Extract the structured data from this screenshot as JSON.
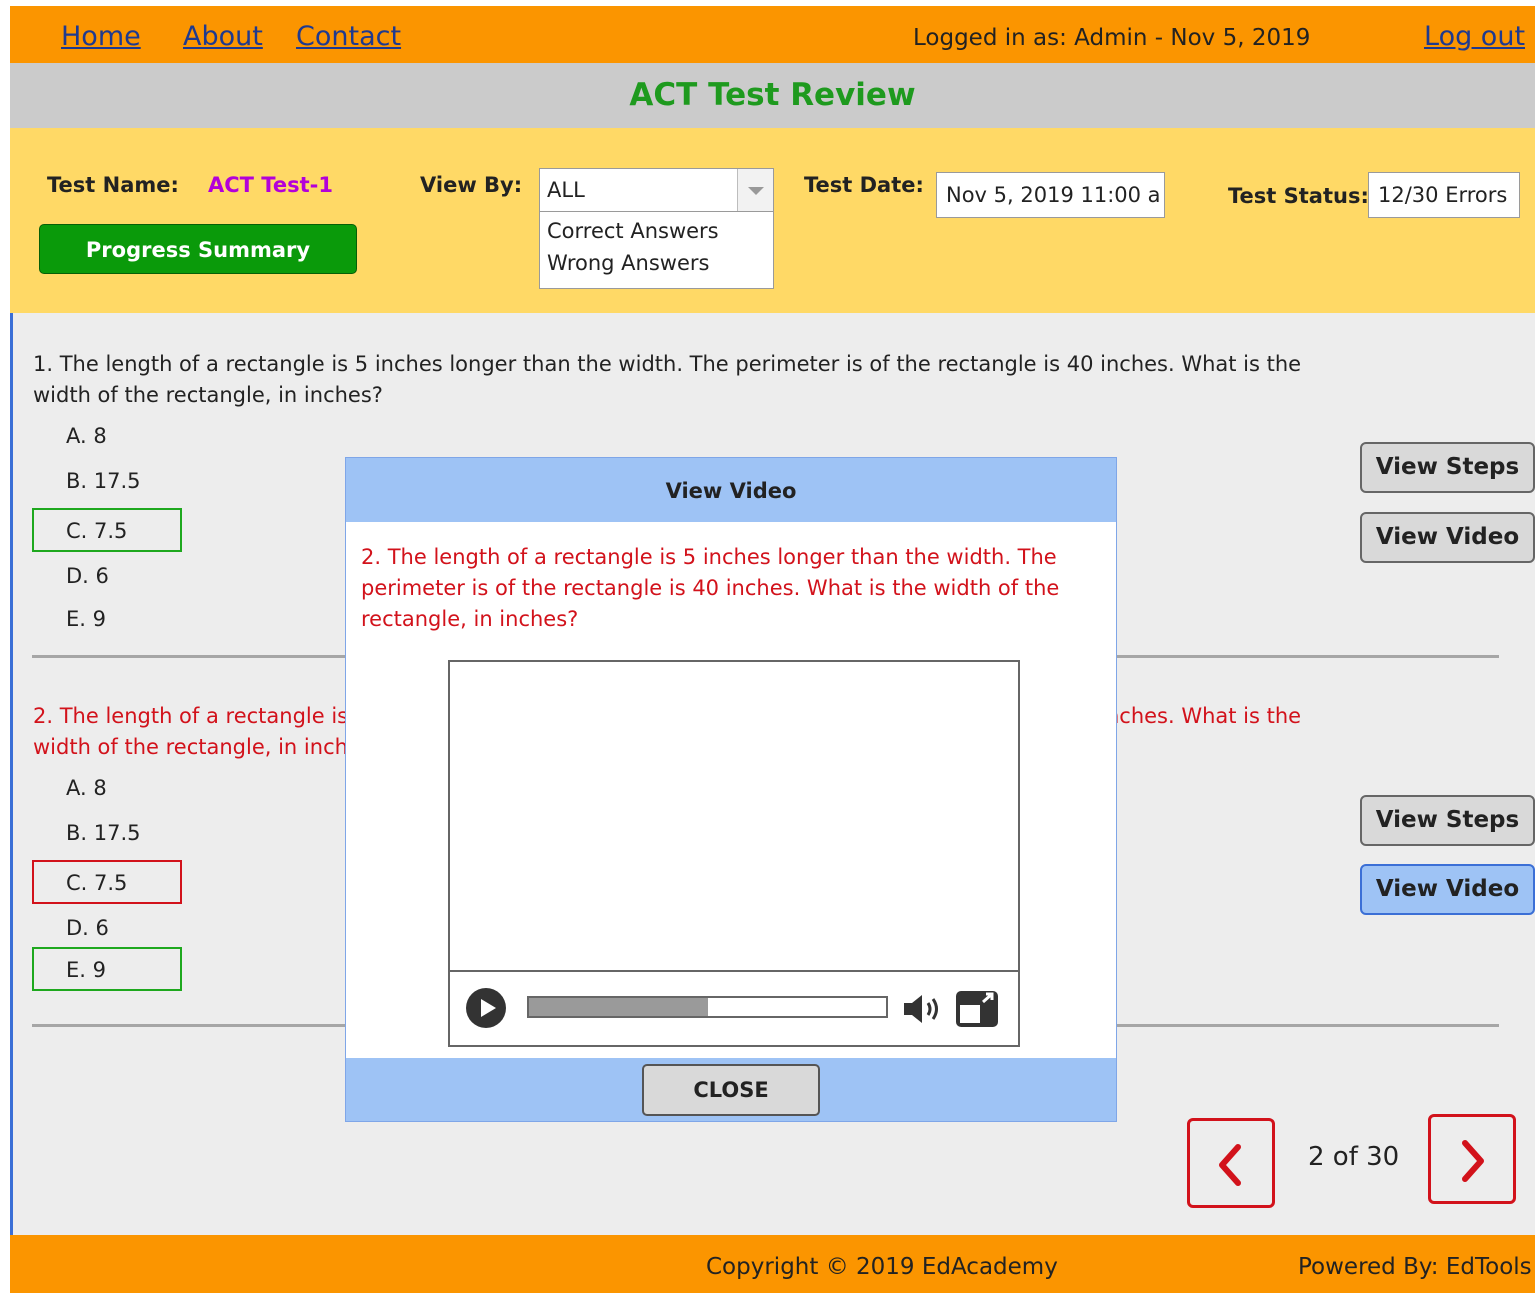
{
  "nav": {
    "home": "Home",
    "about": "About",
    "contact": "Contact",
    "logged_in": "Logged in as: Admin - Nov 5, 2019",
    "logout": "Log out"
  },
  "page_title": "ACT Test Review",
  "filters": {
    "test_name_label": "Test Name:",
    "test_name_value": "ACT Test-1",
    "progress_button": "Progress Summary",
    "view_by_label": "View By:",
    "view_by_selected": "ALL",
    "view_by_options": [
      "Correct Answers",
      "Wrong Answers"
    ],
    "test_date_label": "Test Date:",
    "test_date_value": "Nov 5, 2019 11:00 a",
    "test_status_label": "Test Status:",
    "test_status_value": "12/30 Errors"
  },
  "questions": [
    {
      "text": "1.  The length of a rectangle is 5 inches longer than the width. The perimeter is of the rectangle is 40 inches. What is the width of the rectangle, in inches?",
      "options": [
        "A.  8",
        "B.  17.5",
        "C.  7.5",
        "D.  6",
        "E.  9"
      ]
    },
    {
      "text": "2.  The length of a rectangle is 5 inches longer than the width. The perimeter is of the rectangle is 40 inches. What is the width of the rectangle, in inches?",
      "options": [
        "A.  8",
        "B.  17.5",
        "C.  7.5",
        "D.  6",
        "E.  9"
      ]
    }
  ],
  "buttons": {
    "view_steps": "View Steps",
    "view_video": "View Video"
  },
  "pager": {
    "text": "2 of 30"
  },
  "footer": {
    "copyright": "Copyright © 2019 EdAcademy",
    "powered": "Powered By: EdTools"
  },
  "modal": {
    "title": "View Video",
    "question": "2.  The length of a rectangle is 5 inches longer than the width. The perimeter is of the rectangle is 40 inches. What is the width of the rectangle, in inches?",
    "video_progress": 0.5,
    "close": "CLOSE"
  },
  "icons": {
    "play": "play-icon",
    "volume": "volume-icon",
    "fullscreen": "fullscreen-icon",
    "prev": "chevron-left-icon",
    "next": "chevron-right-icon"
  },
  "colors": {
    "nav_bg": "#fb9500",
    "panel_bg": "#ffd966",
    "title_green": "#1e9a1e",
    "wrong_red": "#d2121b",
    "modal_blue": "#9ec3f5"
  }
}
